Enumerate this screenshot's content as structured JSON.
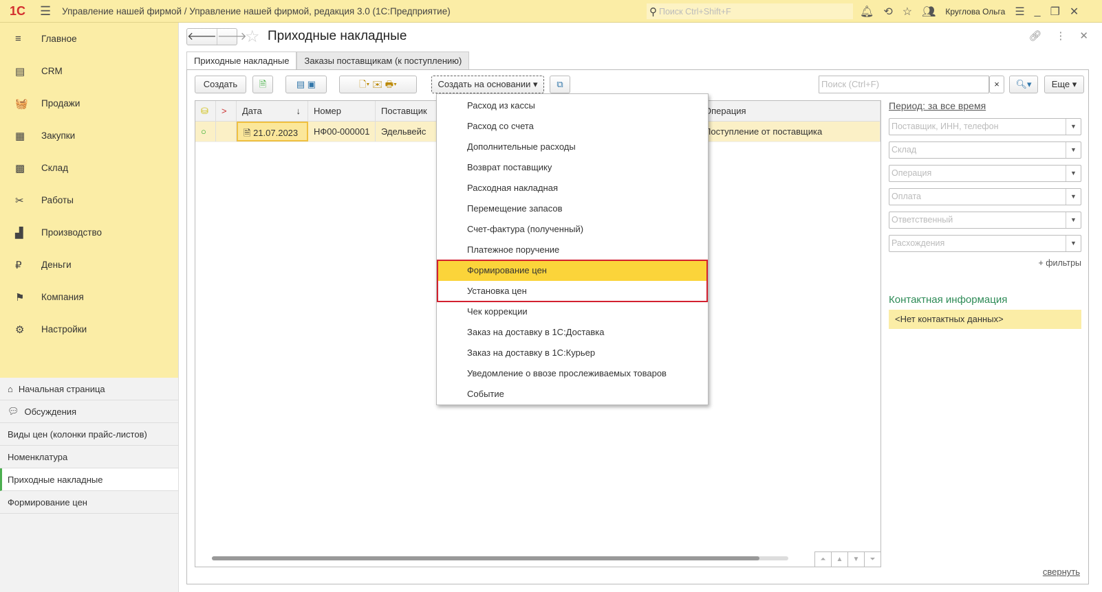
{
  "titlebar": {
    "title": "Управление нашей фирмой / Управление нашей фирмой, редакция 3.0  (1С:Предприятие)",
    "search_placeholder": "Поиск Ctrl+Shift+F",
    "user": "Круглова Ольга"
  },
  "sidebar": {
    "items": [
      {
        "label": "Главное",
        "icon": "≡"
      },
      {
        "label": "CRM",
        "icon": "▤"
      },
      {
        "label": "Продажи",
        "icon": "🧺"
      },
      {
        "label": "Закупки",
        "icon": "▦"
      },
      {
        "label": "Склад",
        "icon": "▩"
      },
      {
        "label": "Работы",
        "icon": "✂"
      },
      {
        "label": "Производство",
        "icon": "▟"
      },
      {
        "label": "Деньги",
        "icon": "₽"
      },
      {
        "label": "Компания",
        "icon": "⚑"
      },
      {
        "label": "Настройки",
        "icon": "⚙"
      }
    ]
  },
  "open_windows": [
    {
      "label": "Начальная страница"
    },
    {
      "label": "Обсуждения"
    },
    {
      "label": "Виды цен (колонки прайс-листов)"
    },
    {
      "label": "Номенклатура"
    },
    {
      "label": "Приходные накладные",
      "active": true
    },
    {
      "label": "Формирование цен"
    }
  ],
  "page": {
    "title": "Приходные накладные",
    "tabs": [
      "Приходные накладные",
      "Заказы поставщикам (к поступлению)"
    ]
  },
  "toolbar": {
    "create": "Создать",
    "create_based": "Создать на основании",
    "search_placeholder": "Поиск (Ctrl+F)",
    "more": "Еще"
  },
  "table": {
    "columns": [
      "Дата",
      "Номер",
      "Поставщик",
      "Операция"
    ],
    "rows": [
      {
        "date": "21.07.2023",
        "number": "НФ00-000001",
        "supplier": "Эдельвейс",
        "operation": "Поступление от поставщика"
      }
    ]
  },
  "menu": {
    "items": [
      "Расход из кассы",
      "Расход со счета",
      "Дополнительные расходы",
      "Возврат поставщику",
      "Расходная накладная",
      "Перемещение запасов",
      "Счет-фактура (полученный)",
      "Платежное поручение",
      "Формирование цен",
      "Установка цен",
      "Чек коррекции",
      "Заказ на доставку в 1С:Доставка",
      "Заказ на доставку в 1С:Курьер",
      "Уведомление о ввозе прослеживаемых товаров",
      "Событие"
    ],
    "highlighted": "Формирование цен"
  },
  "filters": {
    "period": "Период: за все время",
    "fields": [
      "Поставщик, ИНН, телефон",
      "Склад",
      "Операция",
      "Оплата",
      "Ответственный",
      "Расхождения"
    ],
    "more": "+ фильтры",
    "contact_title": "Контактная информация",
    "no_contact": "<Нет контактных данных>",
    "collapse": "свернуть"
  },
  "colors": {
    "accent": "#fbeda6",
    "highlight": "#fbd43a",
    "frame": "#d3202f"
  }
}
